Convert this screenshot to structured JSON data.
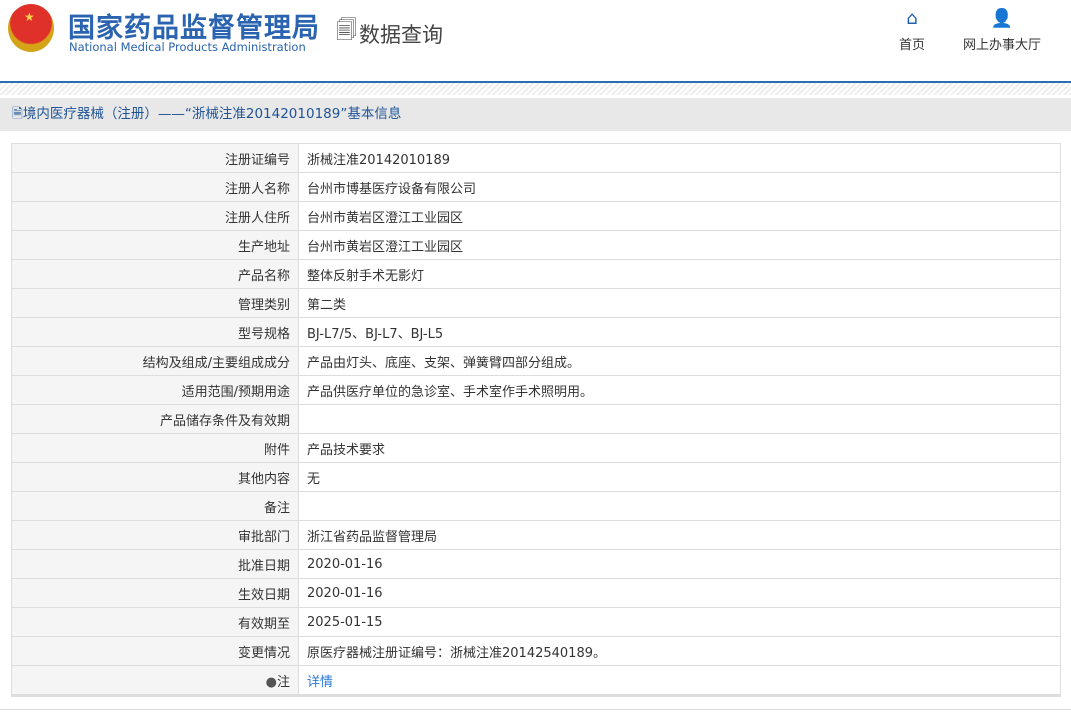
{
  "header": {
    "logo_cn": "国家药品监督管理局",
    "logo_en": "National Medical Products Administration",
    "section": "数据查询",
    "nav": [
      {
        "label": "首页",
        "icon": "home-icon"
      },
      {
        "label": "网上办事大厅",
        "icon": "user-icon"
      }
    ]
  },
  "title": "境内医疗器械（注册）——“浙械注准20142010189”基本信息",
  "rows": [
    {
      "label": "注册证编号",
      "value": "浙械注准20142010189"
    },
    {
      "label": "注册人名称",
      "value": "台州市博基医疗设备有限公司"
    },
    {
      "label": "注册人住所",
      "value": "台州市黄岩区澄江工业园区"
    },
    {
      "label": "生产地址",
      "value": "台州市黄岩区澄江工业园区"
    },
    {
      "label": "产品名称",
      "value": "整体反射手术无影灯"
    },
    {
      "label": "管理类别",
      "value": "第二类"
    },
    {
      "label": "型号规格",
      "value": "BJ-L7/5、BJ-L7、BJ-L5"
    },
    {
      "label": "结构及组成/主要组成成分",
      "value": "产品由灯头、底座、支架、弹簧臂四部分组成。"
    },
    {
      "label": "适用范围/预期用途",
      "value": "产品供医疗单位的急诊室、手术室作手术照明用。"
    },
    {
      "label": "产品储存条件及有效期",
      "value": ""
    },
    {
      "label": "附件",
      "value": "产品技术要求"
    },
    {
      "label": "其他内容",
      "value": "无"
    },
    {
      "label": "备注",
      "value": ""
    },
    {
      "label": "审批部门",
      "value": "浙江省药品监督管理局"
    },
    {
      "label": "批准日期",
      "value": "2020-01-16"
    },
    {
      "label": "生效日期",
      "value": "2020-01-16"
    },
    {
      "label": "有效期至",
      "value": "2025-01-15"
    },
    {
      "label": "变更情况",
      "value": "原医疗器械注册证编号：浙械注准20142540189。"
    }
  ],
  "note": {
    "label": "注",
    "link": "详情"
  }
}
